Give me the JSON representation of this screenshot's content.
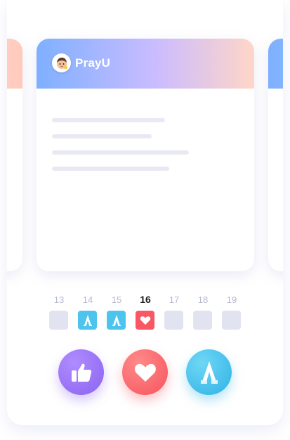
{
  "app": {
    "name": "PrayU"
  },
  "calendar": {
    "days": [
      {
        "num": "13",
        "status": "none"
      },
      {
        "num": "14",
        "status": "pray"
      },
      {
        "num": "15",
        "status": "pray"
      },
      {
        "num": "16",
        "status": "love",
        "today": true
      },
      {
        "num": "17",
        "status": "none"
      },
      {
        "num": "18",
        "status": "none"
      },
      {
        "num": "19",
        "status": "none"
      }
    ]
  },
  "actions": [
    {
      "name": "like",
      "icon": "thumbs-up-icon",
      "color": "#8a63f0"
    },
    {
      "name": "love",
      "icon": "heart-icon",
      "color": "#f6545c"
    },
    {
      "name": "pray",
      "icon": "praying-hands-icon",
      "color": "#2fb2e6"
    }
  ],
  "colors": {
    "header_gradient": [
      "#7eb0ff",
      "#cbbcff",
      "#ffd6c8"
    ],
    "pray": "#4cc4ee",
    "love": "#f85864",
    "empty": "#e2e3f1"
  }
}
